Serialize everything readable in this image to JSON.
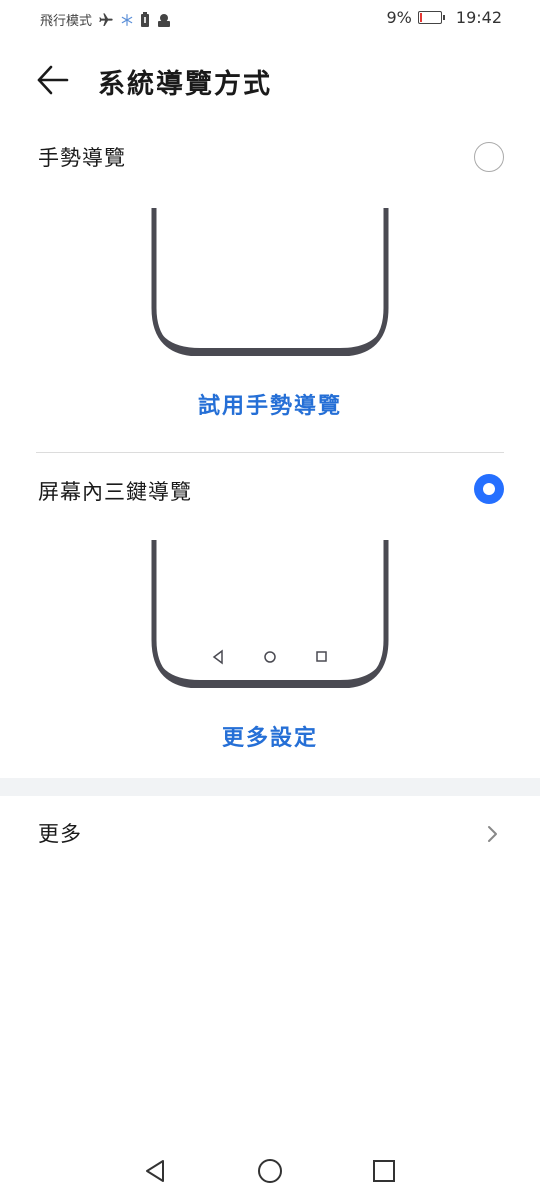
{
  "status_bar": {
    "mode_text": "飛行模式",
    "battery_percent": "9%",
    "time": "19:42",
    "icons": [
      "airplane-icon",
      "snowflake-icon",
      "battery-saver-icon",
      "notification-icon"
    ]
  },
  "header": {
    "title": "系統導覽方式",
    "back_icon": "back-arrow-icon"
  },
  "options": [
    {
      "label": "手勢導覽",
      "selected": false,
      "link_text": "試用手勢導覽"
    },
    {
      "label": "屏幕內三鍵導覽",
      "selected": true,
      "link_text": "更多設定"
    }
  ],
  "more": {
    "label": "更多"
  },
  "colors": {
    "accent": "#256fd6",
    "radio_on": "#256fff",
    "phone_frame": "#4a4a52"
  }
}
